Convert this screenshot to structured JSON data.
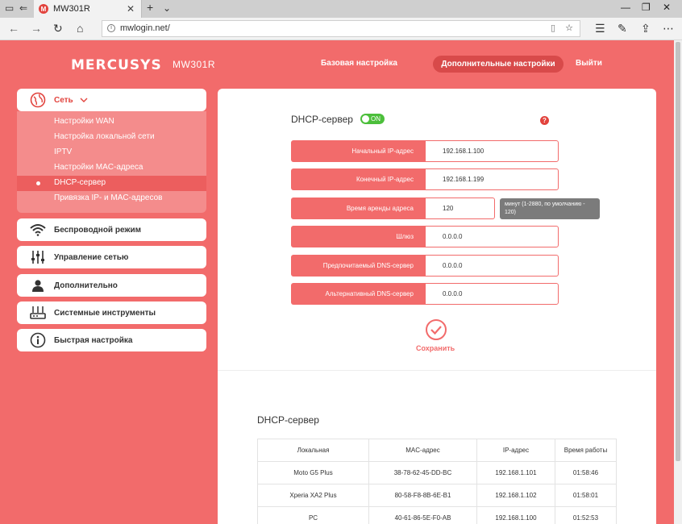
{
  "browser": {
    "tab_title": "MW301R",
    "favicon_letter": "M",
    "url": "mwlogin.net/"
  },
  "header": {
    "brand": "MERCUSYS",
    "model": "MW301R",
    "nav_basic": "Базовая настройка",
    "nav_advanced": "Дополнительные настройки",
    "nav_logout": "Выйти"
  },
  "sidebar": {
    "network": {
      "label": "Сеть",
      "items": [
        "Настройки WAN",
        "Настройка локальной сети",
        "IPTV",
        "Настройки MAC-адреса",
        "DHCP-сервер",
        "Привязка IP- и MAC-адресов"
      ],
      "active_index": 4
    },
    "menus": [
      "Беспроводной режим",
      "Управление сетью",
      "Дополнительно",
      "Системные инструменты",
      "Быстрая настройка"
    ]
  },
  "dhcp_settings": {
    "title": "DHCP-сервер",
    "toggle_label": "ON",
    "help": "?",
    "fields": [
      {
        "label": "Начальный IP-адрес",
        "value": "192.168.1.100"
      },
      {
        "label": "Конечный IP-адрес",
        "value": "192.168.1.199"
      },
      {
        "label": "Время аренды адреса",
        "value": "120"
      },
      {
        "label": "Шлюз",
        "value": "0.0.0.0"
      },
      {
        "label": "Предпочитаемый DNS-сервер",
        "value": "0.0.0.0"
      },
      {
        "label": "Альтернативный DNS-сервер",
        "value": "0.0.0.0"
      }
    ],
    "lease_hint": "минут (1-2880, по умолчанию - 120)",
    "save_label": "Сохранить"
  },
  "clients": {
    "title": "DHCP-сервер",
    "columns": [
      "Локальная",
      "MAC-адрес",
      "IP-адрес",
      "Время работы"
    ],
    "rows": [
      [
        "Moto G5 Plus",
        "38-78-62-45-DD-BC",
        "192.168.1.101",
        "01:58:46"
      ],
      [
        "Xperia XA2 Plus",
        "80-58-F8-8B-6E-B1",
        "192.168.1.102",
        "01:58:01"
      ],
      [
        "PC",
        "40-61-86-5E-F0-AB",
        "192.168.1.100",
        "01:52:53"
      ]
    ]
  },
  "colors": {
    "brand_red": "#f26b6b",
    "toggle_green": "#4cbf3b"
  }
}
